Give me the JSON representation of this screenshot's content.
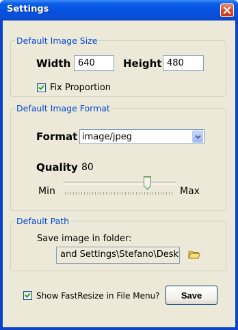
{
  "window": {
    "title": "Settings"
  },
  "image_size": {
    "group_title": "Default Image Size",
    "width_label": "Width",
    "width_value": "640",
    "height_label": "Height",
    "height_value": "480",
    "fix_proportion_label": "Fix Proportion",
    "fix_proportion_checked": true
  },
  "image_format": {
    "group_title": "Default Image Format",
    "format_label": "Format",
    "format_value": "image/jpeg",
    "quality_label": "Quality",
    "quality_value": "80",
    "min_label": "Min",
    "max_label": "Max",
    "quality_level_fraction": 0.8
  },
  "path": {
    "group_title": "Default Path",
    "folder_label": "Save image in folder:",
    "folder_value": "and Settings\\Stefano\\Desktop",
    "browse_icon": "folder-icon"
  },
  "footer": {
    "show_in_menu_label": "Show FastResize in File Menu?",
    "show_in_menu_checked": true,
    "save_label": "Save"
  },
  "colors": {
    "titlebar": "#0551e0",
    "group_title": "#0046d5",
    "dialog_bg": "#ece9d8",
    "close_button": "#d3441f"
  }
}
